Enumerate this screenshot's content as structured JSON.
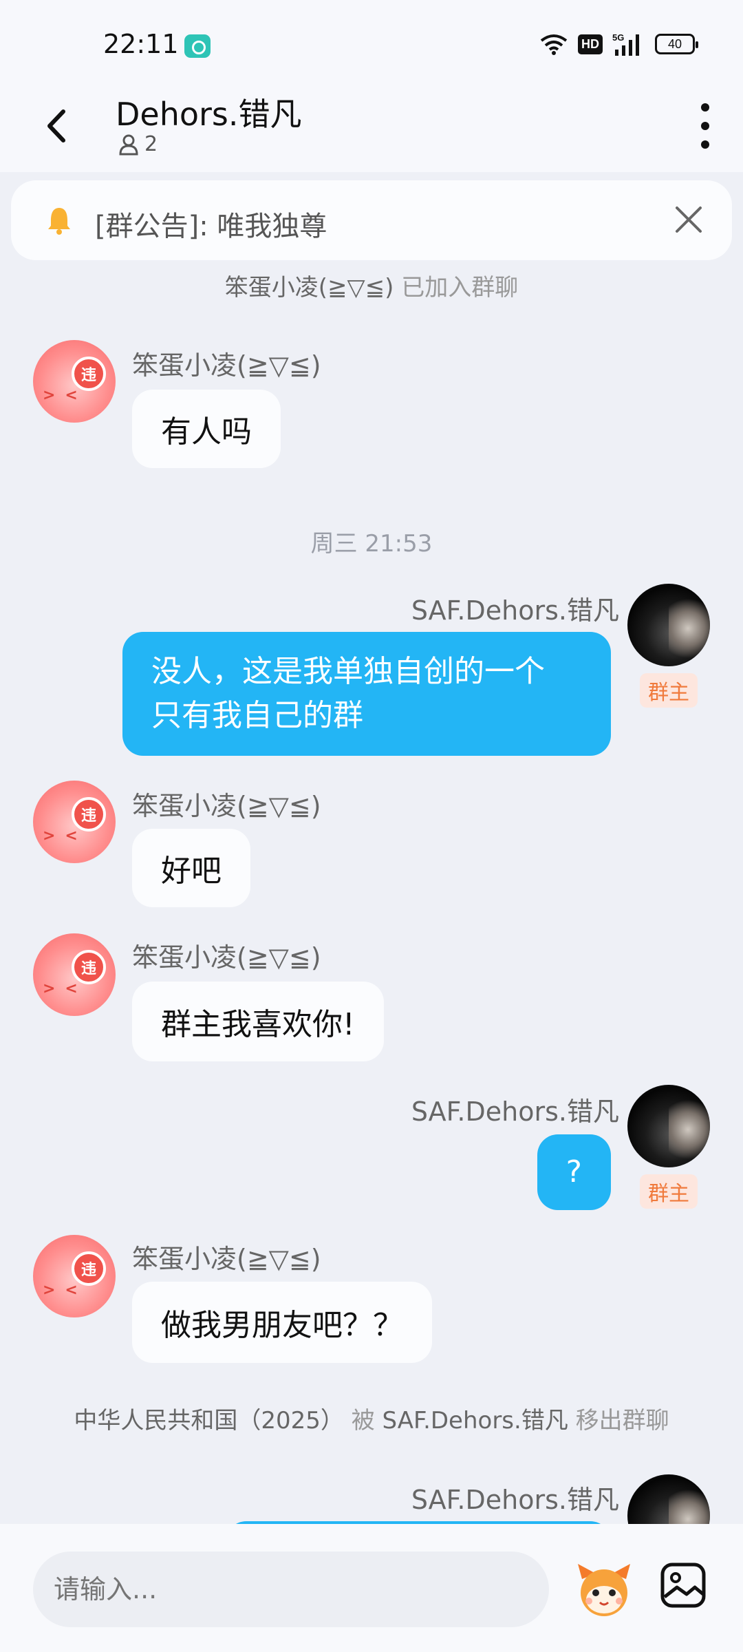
{
  "status_bar": {
    "time": "22:11",
    "hd": "HD",
    "network": "5G",
    "battery": "40"
  },
  "header": {
    "title": "Dehors.错凡",
    "member_count": "2"
  },
  "announcement": {
    "text": "[群公告]: 唯我独尊"
  },
  "system_join": {
    "name": "笨蛋小凌(≧▽≦)",
    "action": "已加入群聊"
  },
  "messages": [
    {
      "sender": "笨蛋小凌(≧▽≦)",
      "text": "有人吗",
      "badge": "违"
    },
    {
      "sender": "SAF.Dehors.错凡",
      "text": "没人，这是我单独自创的一个只有我自己的群",
      "line1": "没人，这是我单独自创的一个",
      "line2": "只有我自己的群",
      "role": "群主"
    },
    {
      "sender": "笨蛋小凌(≧▽≦)",
      "text": "好吧",
      "badge": "违"
    },
    {
      "sender": "笨蛋小凌(≧▽≦)",
      "text": "群主我喜欢你!",
      "badge": "违"
    },
    {
      "sender": "SAF.Dehors.错凡",
      "text": "?",
      "role": "群主"
    },
    {
      "sender": "笨蛋小凌(≧▽≦)",
      "text": "做我男朋友吧？？",
      "badge": "违"
    },
    {
      "sender": "SAF.Dehors.错凡"
    }
  ],
  "timestamp": "周三 21:53",
  "system_kick": {
    "target": "中华人民共和国（2025）",
    "by": "被",
    "actor": "SAF.Dehors.错凡",
    "action": "移出群聊"
  },
  "input": {
    "placeholder": "请输入..."
  },
  "colors": {
    "bubble_self": "#23b5f5",
    "background": "#eef0f6",
    "owner_badge": "#f07a3c"
  }
}
